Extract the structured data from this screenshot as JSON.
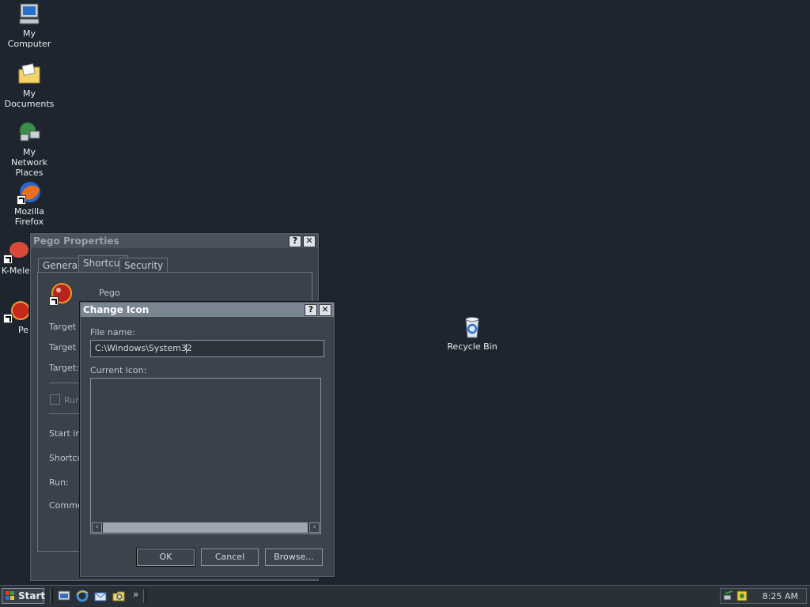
{
  "desktop": {
    "icons": [
      {
        "label": "My Computer"
      },
      {
        "label": "My Documents"
      },
      {
        "label": "My Network Places"
      },
      {
        "label": "Mozilla Firefox"
      },
      {
        "label": "K-Mele"
      },
      {
        "label": "Pe"
      },
      {
        "label": "Recycle Bin"
      }
    ]
  },
  "properties_window": {
    "title": "Pego Properties",
    "tabs": [
      "General",
      "Shortcut",
      "Security"
    ],
    "active_tab": "Shortcut",
    "shortcut_name": "Pego",
    "fields": [
      "Target ty",
      "Target lo",
      "Target:",
      "Run",
      "Start in:",
      "Shortcu",
      "Run:",
      "Commen"
    ]
  },
  "change_icon_dialog": {
    "title": "Change Icon",
    "file_name_label": "File name:",
    "file_name_value": "C:\\Windows\\System32",
    "current_icon_label": "Current icon:",
    "ok_label": "OK",
    "cancel_label": "Cancel",
    "browse_label": "Browse..."
  },
  "taskbar": {
    "start_label": "Start",
    "quicklaunch_more": "»",
    "clock": "8:25 AM"
  },
  "colors": {
    "desktop_bg": "#1f252e",
    "dialog_title_bg": "#7a8592"
  }
}
